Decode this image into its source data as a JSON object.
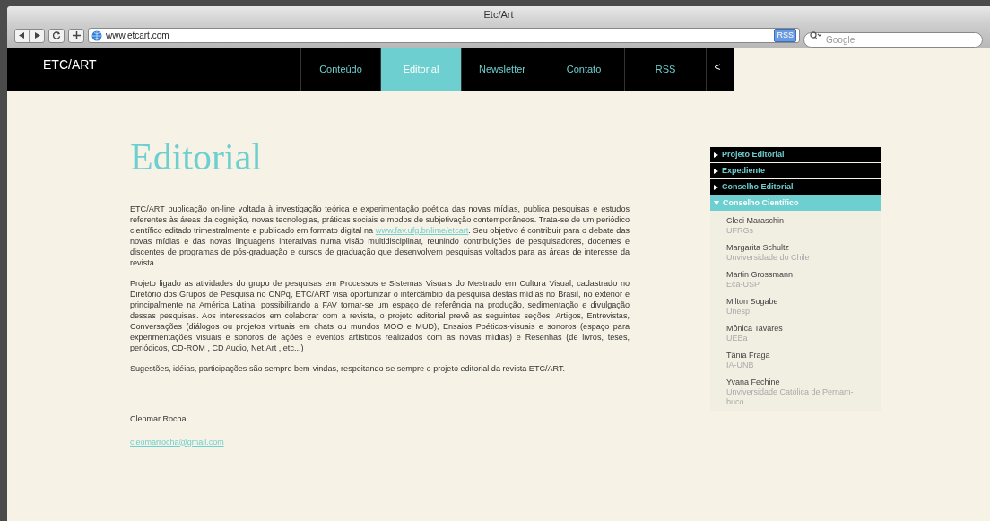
{
  "window": {
    "title": "Etc/Art"
  },
  "toolbar": {
    "url": "www.etcart.com",
    "rss_badge": "RSS",
    "search": {
      "placeholder": "Google"
    }
  },
  "site": {
    "logo": "ETC/ART",
    "nav": [
      {
        "label": "Conteúdo",
        "selected": false
      },
      {
        "label": "Editorial",
        "selected": true
      },
      {
        "label": "Newsletter",
        "selected": false
      },
      {
        "label": "Contato",
        "selected": false
      },
      {
        "label": "RSS",
        "selected": false
      }
    ],
    "nav_toggle": "<"
  },
  "article": {
    "title": "Editorial",
    "paragraphs": [
      {
        "text": "ETC/ART publicação on-line voltada à investigação teórica e experimentação poética das novas mídias, publica pesquisas e estudos referentes às áreas da cognição, novas tecnologias, práticas sociais e modos de subjetivação contemporâneos. Trata-se de um periódico científico editado trimestralmente e publicado em formato digital na ",
        "link": "www.fav.ufg.br/lime/etcart",
        "text_after": ". Seu objetivo é contribuir para o debate das novas mídias e das novas linguagens interativas numa visão multidisciplinar, reunindo contribuições de pesquisadores, docentes e discentes de programas de pós-graduação e cursos de graduação que desenvolvem pesquisas voltados para as áreas de interesse da revista."
      },
      {
        "text": "Projeto ligado as atividades do grupo de pesquisas em Processos e Sistemas Visuais do Mestrado em Cultura Visual, cadastrado no Diretório dos Grupos de Pesquisa no CNPq, ETC/ART visa oportunizar o intercâmbio da pesquisa destas mídias no Brasil, no exterior e principalmente na América Latina, possibilitando a FAV tornar-se um espaço de referência na produção, sedimentação e divulgação dessas pesquisas. Aos interessados em colaborar com a revista, o projeto editorial prevê as seguintes seções: Artigos, Entrevistas, Conversações (diálogos ou projetos virtuais em chats ou mundos MOO e MUD), Ensaios Poéticos-visuais e sonoros (espaço para experimentações visuais e sonoros de ações e eventos artísticos realizados com as novas mídias) e Resenhas (de livros, teses, periódicos, CD-ROM , CD Audio, Net.Art , etc...)"
      },
      {
        "text": "Sugestões, idéias, participações são sempre bem-vindas, respeitando-se sempre o projeto editorial da revista ETC/ART."
      }
    ],
    "author": "Cleomar Rocha",
    "email": "cleomarrocha@gmail.com"
  },
  "sidebar": {
    "sections": [
      {
        "label": "Projeto Editorial",
        "expanded": false
      },
      {
        "label": "Expediente",
        "expanded": false
      },
      {
        "label": "Conselho Editorial",
        "expanded": false
      },
      {
        "label": "Conselho Científico",
        "expanded": true,
        "members": [
          {
            "name": "Cleci Maraschin",
            "institution": "UFRGs"
          },
          {
            "name": "Margarita Schultz",
            "institution": "Unviversidade do Chile"
          },
          {
            "name": "Martin Grossmann",
            "institution": "Eca-USP"
          },
          {
            "name": "Milton Sogabe",
            "institution": "Unesp"
          },
          {
            "name": "Mônica Tavares",
            "institution": "UEBa"
          },
          {
            "name": "Tânia Fraga",
            "institution": "IA-UNB"
          },
          {
            "name": "Yvana Fechine",
            "institution": "Unviversidade Católica de Pernam-buco"
          }
        ]
      }
    ]
  }
}
